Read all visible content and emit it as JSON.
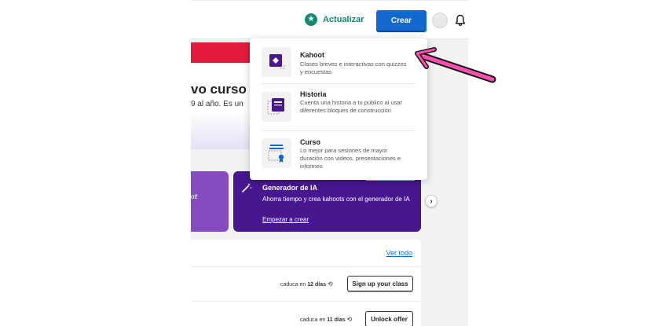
{
  "header": {
    "upgrade_label": "Actualizar",
    "create_label": "Crear"
  },
  "promo": {
    "title_fragment": "vo curso",
    "subtitle_fragment": "9 al año. Es un"
  },
  "cards": {
    "left_fragment": "ot!",
    "ai": {
      "title": "Generador de IA",
      "description": "Ahorra tiempo y crea kahoots con el generador de IA",
      "link": "Empezar a crear"
    }
  },
  "list": {
    "see_all": "Ver todo",
    "rows": [
      {
        "expiry_prefix": "caduca en",
        "expiry_days": "12 días",
        "action": "Sign up your class"
      },
      {
        "expiry_prefix": "caduca en",
        "expiry_days": "11 días",
        "action": "Unlock offer"
      }
    ]
  },
  "create_menu": {
    "items": [
      {
        "title": "Kahoot",
        "description": "Clases breves e interactivas con quizzes y encuestas",
        "icon": "kahoot-icon"
      },
      {
        "title": "Historia",
        "description": "Cuenta una historia a tu público al usar diferentes bloques de construcción",
        "icon": "story-icon"
      },
      {
        "title": "Curso",
        "description": "Lo mejor para sesiones de mayor duración con videos, presentaciones e informes",
        "icon": "course-icon"
      }
    ]
  },
  "colors": {
    "primary_blue": "#1368ce",
    "upgrade_green": "#138a72",
    "ai_purple": "#46178f",
    "banner_red": "#e21b3c",
    "annotation_pink": "#ff4fb3"
  }
}
